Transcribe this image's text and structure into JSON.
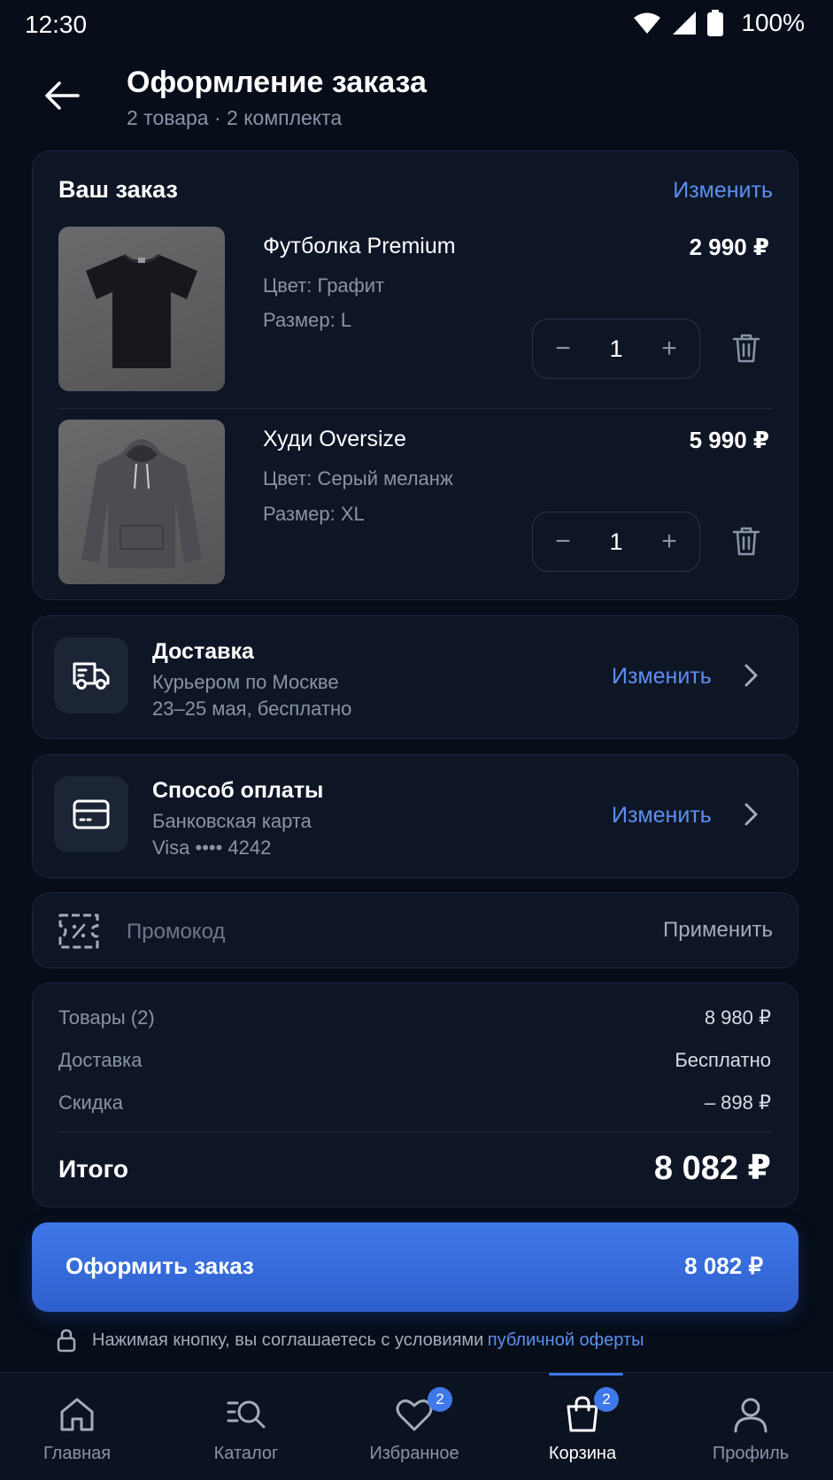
{
  "status_bar": {
    "time": "12:30",
    "battery": "100%"
  },
  "header": {
    "title": "Оформление заказа",
    "subtitle": "2 товара · 2  комплекта"
  },
  "order": {
    "title": "Ваш заказ",
    "edit_label": "Изменить",
    "items": [
      {
        "name": "Футболка Premium",
        "color": "Цвет: Графит",
        "size": "Размер: L",
        "price": "2 990 ₽",
        "qty": "1"
      },
      {
        "name": "Худи Oversize",
        "color": "Цвет:  Серый меланж",
        "size": "Размер: XL",
        "price": "5 990 ₽",
        "qty": "1"
      }
    ]
  },
  "delivery": {
    "title": "Доставка",
    "line1": "Курьером по Москве",
    "line2": "23–25 мая, бесплатно",
    "edit_label": "Изменить"
  },
  "payment": {
    "title": "Способ оплаты",
    "line1": "Банковская карта",
    "line2": "Visa •••• 4242",
    "edit_label": "Изменить"
  },
  "promo": {
    "placeholder": "Промокод",
    "apply_label": "Применить"
  },
  "summary": {
    "goods_label": "Товары (2)",
    "goods_value": "8 980 ₽",
    "delivery_label": "Доставка",
    "delivery_value": "Бесплатно",
    "discount_label": "Скидка",
    "discount_value": "– 898 ₽",
    "total_label": "Итого",
    "total_value": "8 082 ₽"
  },
  "cta": {
    "label": "Оформить заказ",
    "price": "8 082 ₽"
  },
  "terms": {
    "text": "Нажимая кнопку, вы соглашаетесь с условиями",
    "link": "публичной оферты"
  },
  "nav": {
    "items": [
      {
        "label": "Главная",
        "icon": "home-icon"
      },
      {
        "label": "Каталог",
        "icon": "catalog-search-icon"
      },
      {
        "label": "Избранное",
        "icon": "heart-icon",
        "badge": "2"
      },
      {
        "label": "Корзина",
        "icon": "bag-icon",
        "badge": "2",
        "active": true
      },
      {
        "label": "Профиль",
        "icon": "user-icon"
      }
    ]
  },
  "colors": {
    "accent": "#3f78ea",
    "link": "#5b8ff0",
    "background": "#070d19",
    "card": "#0e1626"
  }
}
